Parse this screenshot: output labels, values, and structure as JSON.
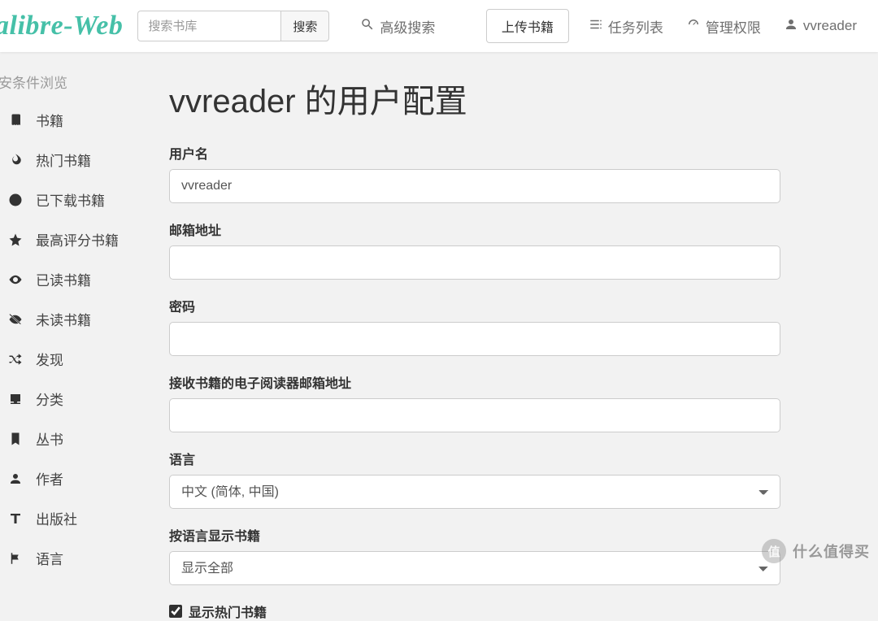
{
  "brand": "alibre-Web",
  "nav": {
    "search_placeholder": "搜索书库",
    "search_button": "搜索",
    "advanced_search": "高级搜索",
    "upload": "上传书籍",
    "tasks": "任务列表",
    "admin": "管理权限",
    "user": "vvreader"
  },
  "sidebar": {
    "heading": "安条件浏览",
    "items": [
      {
        "icon": "book",
        "label": "书籍"
      },
      {
        "icon": "fire",
        "label": "热门书籍"
      },
      {
        "icon": "download",
        "label": "已下载书籍"
      },
      {
        "icon": "star",
        "label": "最高评分书籍"
      },
      {
        "icon": "eye",
        "label": "已读书籍"
      },
      {
        "icon": "eye-slash",
        "label": "未读书籍"
      },
      {
        "icon": "shuffle",
        "label": "发现"
      },
      {
        "icon": "inbox",
        "label": "分类"
      },
      {
        "icon": "bookmark",
        "label": "丛书"
      },
      {
        "icon": "user",
        "label": "作者"
      },
      {
        "icon": "font",
        "label": "出版社"
      },
      {
        "icon": "flag",
        "label": "语言"
      }
    ]
  },
  "page": {
    "title": "vvreader 的用户配置",
    "form": {
      "username_label": "用户名",
      "username_value": "vvreader",
      "email_label": "邮箱地址",
      "email_value": "",
      "password_label": "密码",
      "password_value": "",
      "ereader_label": "接收书籍的电子阅读器邮箱地址",
      "ereader_value": "",
      "language_label": "语言",
      "language_value": "中文 (简体, 中国)",
      "book_language_label": "按语言显示书籍",
      "book_language_value": "显示全部",
      "show_hot_label": "显示热门书籍",
      "show_hot_checked": true
    }
  },
  "watermark": {
    "badge": "值",
    "text": "什么值得买"
  }
}
